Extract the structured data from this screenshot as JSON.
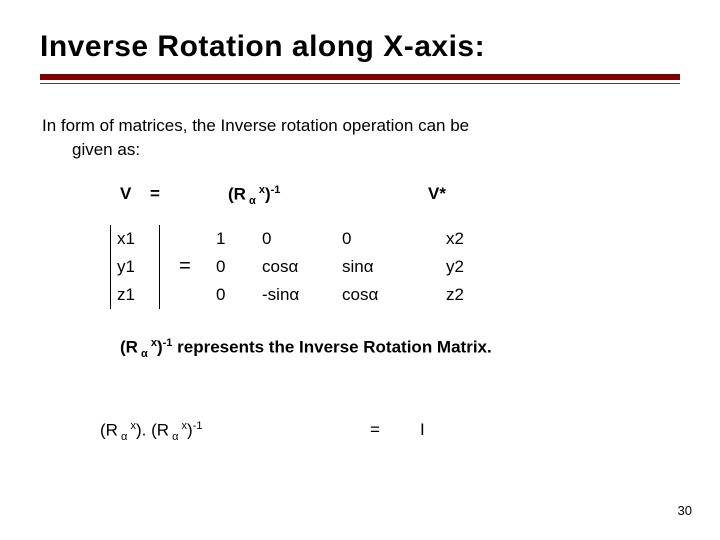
{
  "title": "Inverse Rotation along X-axis:",
  "intro_l1": "In form of matrices, the Inverse rotation operation can be",
  "intro_l2": "given as:",
  "hdr": {
    "v": "V",
    "eq": "=",
    "r_open": "(R",
    "r_sub": " α ",
    "r_sup": "x",
    "r_close": ")",
    "r_exp": "-1",
    "vstar": "V*"
  },
  "vec1": {
    "a": "x1",
    "b": "y1",
    "c": "z1"
  },
  "eqsym": "=",
  "mcol1": {
    "a": "1",
    "b": "0",
    "c": "0"
  },
  "mcol2": {
    "a": "0",
    "b": "cosα",
    "c": "-sinα"
  },
  "mcol3": {
    "a": "0",
    "b": "sinα",
    "c": "cosα"
  },
  "vec2": {
    "a": "x2",
    "b": "y2",
    "c": "z2"
  },
  "note": {
    "r_open": "(R",
    "r_sub": " α ",
    "r_sup": "x",
    "r_close": ")",
    "r_exp": "-1",
    "rest": " represents the Inverse Rotation Matrix."
  },
  "bottom": {
    "a_open": "(R",
    "a_sub": " α ",
    "a_sup": "x",
    "a_close": ")",
    "dot": ". ",
    "b_open": "(R",
    "b_sub": " α ",
    "b_sup": "x",
    "b_close": ")",
    "b_exp": "-1",
    "eq": "=",
    "rhs": "I"
  },
  "slide_number": "30"
}
